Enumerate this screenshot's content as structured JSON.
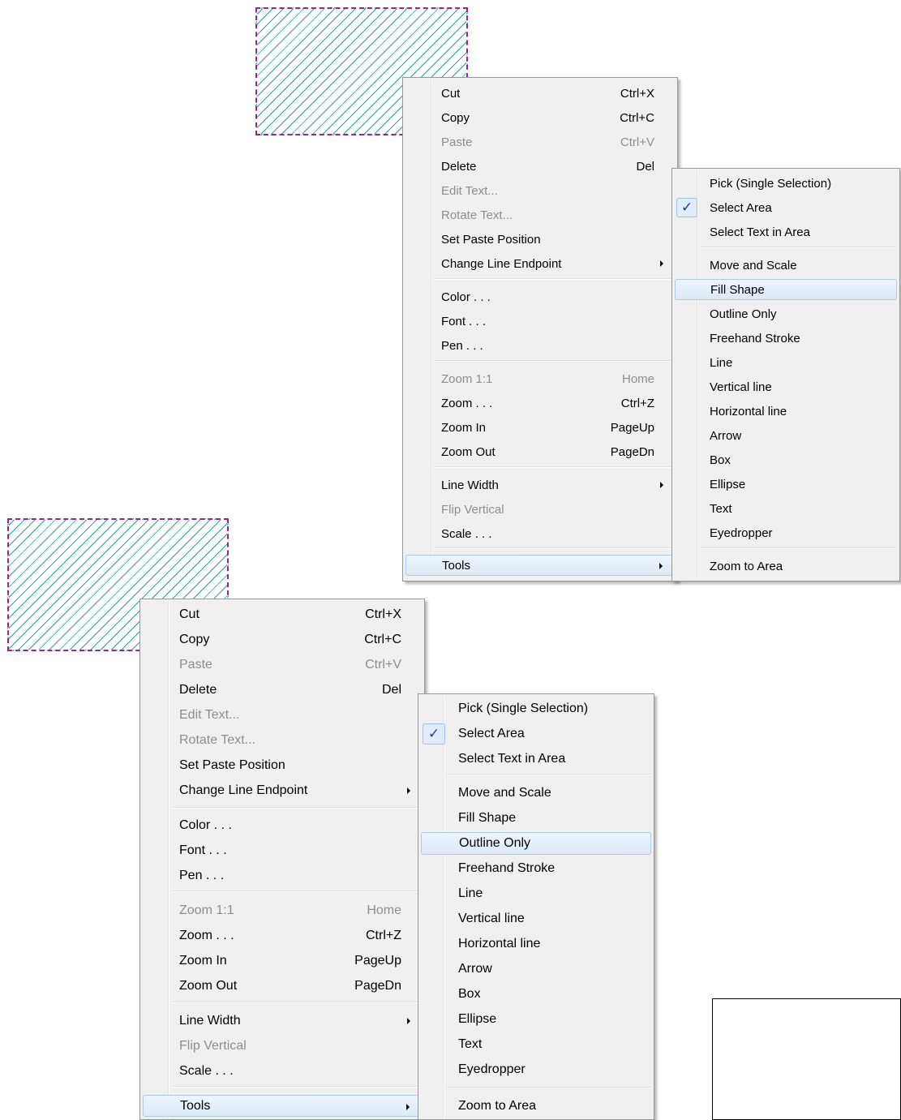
{
  "menu": {
    "items": [
      {
        "label": "Cut",
        "shortcut": "Ctrl+X",
        "enabled": true
      },
      {
        "label": "Copy",
        "shortcut": "Ctrl+C",
        "enabled": true
      },
      {
        "label": "Paste",
        "shortcut": "Ctrl+V",
        "enabled": false
      },
      {
        "label": "Delete",
        "shortcut": "Del",
        "enabled": true
      },
      {
        "label": "Edit Text...",
        "shortcut": "",
        "enabled": false
      },
      {
        "label": "Rotate Text...",
        "shortcut": "",
        "enabled": false
      },
      {
        "label": "Set Paste Position",
        "shortcut": "",
        "enabled": true
      },
      {
        "label": "Change Line Endpoint",
        "shortcut": "",
        "enabled": true,
        "submenu": true
      },
      {
        "separator": true
      },
      {
        "label": "Color . . .",
        "shortcut": "",
        "enabled": true
      },
      {
        "label": "Font . . .",
        "shortcut": "",
        "enabled": true
      },
      {
        "label": "Pen . . .",
        "shortcut": "",
        "enabled": true
      },
      {
        "separator": true
      },
      {
        "label": "Zoom 1:1",
        "shortcut": "Home",
        "enabled": false
      },
      {
        "label": "Zoom . . .",
        "shortcut": "Ctrl+Z",
        "enabled": true
      },
      {
        "label": "Zoom In",
        "shortcut": "PageUp",
        "enabled": true
      },
      {
        "label": "Zoom Out",
        "shortcut": "PageDn",
        "enabled": true
      },
      {
        "separator": true
      },
      {
        "label": "Line Width",
        "shortcut": "",
        "enabled": true,
        "submenu": true
      },
      {
        "label": "Flip Vertical",
        "shortcut": "",
        "enabled": false
      },
      {
        "label": "Scale . . .",
        "shortcut": "",
        "enabled": true
      },
      {
        "separator": true
      },
      {
        "label": "Tools",
        "shortcut": "",
        "enabled": true,
        "submenu": true,
        "highlighted": true
      }
    ]
  },
  "tools_submenu": {
    "items": [
      {
        "label": "Pick (Single Selection)"
      },
      {
        "label": "Select Area",
        "checked": true
      },
      {
        "label": "Select Text in Area"
      },
      {
        "separator": true
      },
      {
        "label": "Move and Scale"
      },
      {
        "label": "Fill Shape"
      },
      {
        "label": "Outline Only"
      },
      {
        "label": "Freehand Stroke"
      },
      {
        "label": "Line"
      },
      {
        "label": "Vertical line"
      },
      {
        "label": "Horizontal line"
      },
      {
        "label": "Arrow"
      },
      {
        "label": "Box"
      },
      {
        "label": "Ellipse"
      },
      {
        "label": "Text"
      },
      {
        "label": "Eyedropper"
      },
      {
        "separator": true
      },
      {
        "label": "Zoom to Area"
      }
    ]
  },
  "checkmark_glyph": "✓",
  "instances": [
    {
      "name": "top",
      "highlighted_tool": "Fill Shape"
    },
    {
      "name": "bottom",
      "highlighted_tool": "Outline Only"
    }
  ],
  "colors": {
    "hatch_border": "#a0208c",
    "hatch_lines": "#22a8a0",
    "menu_background": "#f0f0f0",
    "highlight_border": "#aecbef"
  }
}
